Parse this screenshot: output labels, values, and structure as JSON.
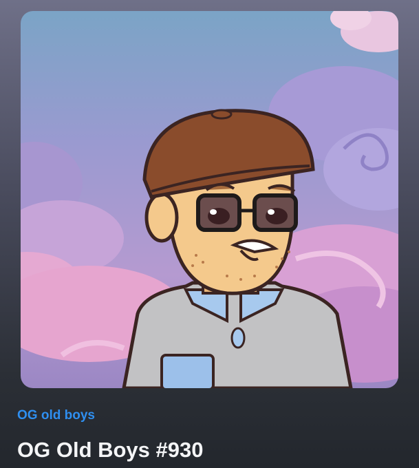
{
  "nft": {
    "collection_name": "OG old boys",
    "title": "OG Old Boys #930",
    "image_icon": "cartoon-old-man-avatar"
  },
  "colors": {
    "collection_link": "#2f8ff0",
    "title_text": "#f4f5f7",
    "page_bottom": "#23272d",
    "cap": "#8a4c2c",
    "skin": "#f4c98c",
    "shirt": "#c2c2c4",
    "collar": "#a7c9ee"
  }
}
